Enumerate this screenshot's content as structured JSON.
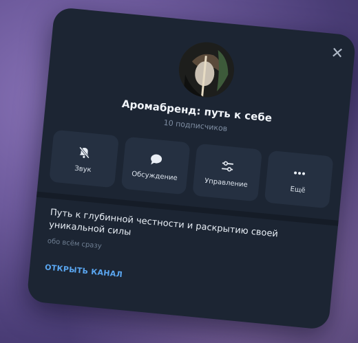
{
  "channel": {
    "name": "Аромабренд: путь к себе",
    "subscribers": "10 подписчиков"
  },
  "actions": [
    {
      "label": "Звук",
      "icon": "mute-bell-icon"
    },
    {
      "label": "Обсуждение",
      "icon": "chat-bubble-icon"
    },
    {
      "label": "Управление",
      "icon": "sliders-icon"
    },
    {
      "label": "Ещё",
      "icon": "more-dots-icon"
    }
  ],
  "description": {
    "text": "Путь к глубинной честности и раскрытию своей уникальной силы",
    "caption": "обо всём сразу"
  },
  "open_channel_label": "ОТКРЫТЬ КАНАЛ",
  "colors": {
    "card_bg": "#1c2533",
    "button_bg": "#253041",
    "link": "#5aa6f0",
    "background": "#6d5a9c"
  }
}
